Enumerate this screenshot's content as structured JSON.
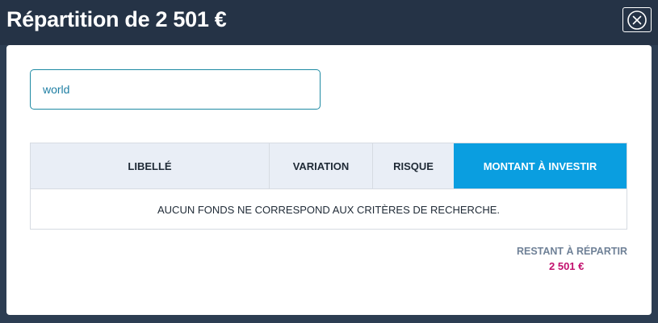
{
  "modal": {
    "title": "Répartition de 2 501 €",
    "close_icon": "close-circle-icon"
  },
  "search": {
    "value": "world"
  },
  "table": {
    "columns": [
      "LIBELLÉ",
      "VARIATION",
      "RISQUE",
      "MONTANT À INVESTIR"
    ],
    "active_column_color": "#0a9ee0",
    "empty_message": "AUCUN FONDS NE CORRESPOND AUX CRITÈRES DE RECHERCHE."
  },
  "remaining": {
    "label": "RESTANT À RÉPARTIR",
    "amount": "2 501 €",
    "amount_color": "#c2106e"
  }
}
